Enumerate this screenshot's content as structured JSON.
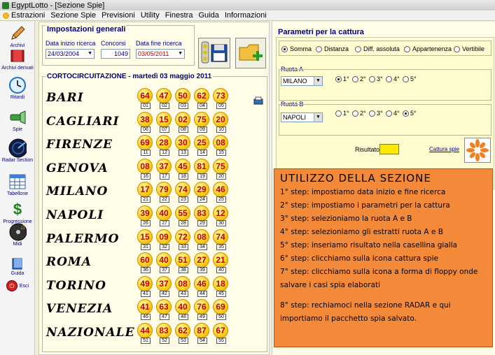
{
  "window": {
    "title": "EgyptLotto - [Sezione Spie]"
  },
  "menu": [
    "Estrazioni",
    "Sezione Spie",
    "Previsioni",
    "Utility",
    "Finestra",
    "Guida",
    "Informazioni"
  ],
  "sidebar": {
    "items": [
      {
        "label": "Archivi",
        "icon": "pencil-icon"
      },
      {
        "label": "Archivi derivati",
        "icon": "book-icon"
      },
      {
        "label": "Ritardi",
        "icon": "clock-icon"
      },
      {
        "label": "Spie",
        "icon": "flashlight-icon"
      },
      {
        "label": "Radar Section",
        "icon": "radar-icon"
      },
      {
        "label": "Tabellone",
        "icon": "table-icon"
      },
      {
        "label": "Progressione",
        "icon": "dollar-icon"
      },
      {
        "label": "Midi",
        "icon": "music-icon"
      },
      {
        "label": "Guida",
        "icon": "help-book-icon"
      },
      {
        "label": "Esci",
        "icon": "exit-icon"
      }
    ]
  },
  "settings": {
    "title": "Impostazioni generali",
    "start_label": "Data inizio ricerca",
    "start_value": "24/03/2004",
    "contests_label": "Concorsi",
    "contests_value": "1049",
    "end_label": "Data fine ricerca",
    "end_value": "03/05/2011"
  },
  "draw": {
    "title": "CORTOCIRCUITAZIONE - martedì 03 maggio 2011",
    "wheels": [
      {
        "name": "BARI",
        "numbers": [
          "64",
          "47",
          "50",
          "62",
          "73"
        ],
        "pos": [
          "01",
          "02",
          "03",
          "04",
          "05"
        ]
      },
      {
        "name": "CAGLIARI",
        "numbers": [
          "38",
          "15",
          "02",
          "75",
          "20"
        ],
        "pos": [
          "06",
          "07",
          "08",
          "09",
          "10"
        ]
      },
      {
        "name": "FIRENZE",
        "numbers": [
          "69",
          "28",
          "30",
          "25",
          "08"
        ],
        "pos": [
          "11",
          "12",
          "13",
          "14",
          "15"
        ]
      },
      {
        "name": "GENOVA",
        "numbers": [
          "08",
          "37",
          "45",
          "81",
          "75"
        ],
        "pos": [
          "16",
          "17",
          "18",
          "19",
          "20"
        ]
      },
      {
        "name": "MILANO",
        "numbers": [
          "17",
          "79",
          "74",
          "29",
          "46"
        ],
        "pos": [
          "21",
          "22",
          "23",
          "24",
          "25"
        ]
      },
      {
        "name": "NAPOLI",
        "numbers": [
          "39",
          "40",
          "55",
          "83",
          "12"
        ],
        "pos": [
          "26",
          "27",
          "28",
          "29",
          "30"
        ]
      },
      {
        "name": "PALERMO",
        "numbers": [
          "15",
          "09",
          "72",
          "08",
          "74"
        ],
        "pos": [
          "31",
          "32",
          "33",
          "34",
          "35"
        ]
      },
      {
        "name": "ROMA",
        "numbers": [
          "60",
          "40",
          "51",
          "27",
          "21"
        ],
        "pos": [
          "36",
          "37",
          "38",
          "39",
          "40"
        ]
      },
      {
        "name": "TORINO",
        "numbers": [
          "49",
          "37",
          "08",
          "46",
          "18"
        ],
        "pos": [
          "41",
          "42",
          "43",
          "44",
          "45"
        ]
      },
      {
        "name": "VENEZIA",
        "numbers": [
          "41",
          "63",
          "40",
          "76",
          "69"
        ],
        "pos": [
          "46",
          "47",
          "48",
          "49",
          "50"
        ]
      },
      {
        "name": "NAZIONALE",
        "numbers": [
          "44",
          "83",
          "62",
          "87",
          "67"
        ],
        "pos": [
          "51",
          "52",
          "53",
          "54",
          "55"
        ]
      }
    ]
  },
  "capture": {
    "title": "Parametri per la cattura",
    "modes": [
      "Somma",
      "Distanza",
      "Diff. assoluta",
      "Appartenenza",
      "Vertibile"
    ],
    "selected_mode": "Somma",
    "ruota_a_label": "Ruota A",
    "ruota_a_value": "MILANO",
    "ruota_b_label": "Ruota B",
    "ruota_b_value": "NAPOLI",
    "positions": [
      "1°",
      "2°",
      "3°",
      "4°",
      "5°"
    ],
    "ruota_a_selected": "1°",
    "ruota_b_selected": "5°",
    "result_label": "Risultato",
    "result_value": "",
    "capture_link": "Cattura spie"
  },
  "notes": {
    "title": "UTILIZZO DELLA SEZIONE",
    "lines": [
      "1° step: impostiamo data inizio e fine ricerca",
      "2° step: impostiamo i parametri per la cattura",
      "3° step: selezioniamo la ruota A e B",
      "4° step: selezioniamo gli estratti ruota A e B",
      "5° step: inseriamo risultato nella casellina gialla",
      "6° step: clicchiamo sulla icona cattura spie",
      "7° step: clicchiamo sulla icona a forma di floppy onde salvare i casi spia elaborati",
      "",
      "8° step: rechiamoci nella sezione RADAR e qui importiamo il pacchetto spia salvato."
    ]
  },
  "colors": {
    "background": "#f2eed8",
    "panel": "#fffde8",
    "accent": "#000080",
    "notes_bg": "#f28a3a",
    "ball_number": "#c00000"
  }
}
